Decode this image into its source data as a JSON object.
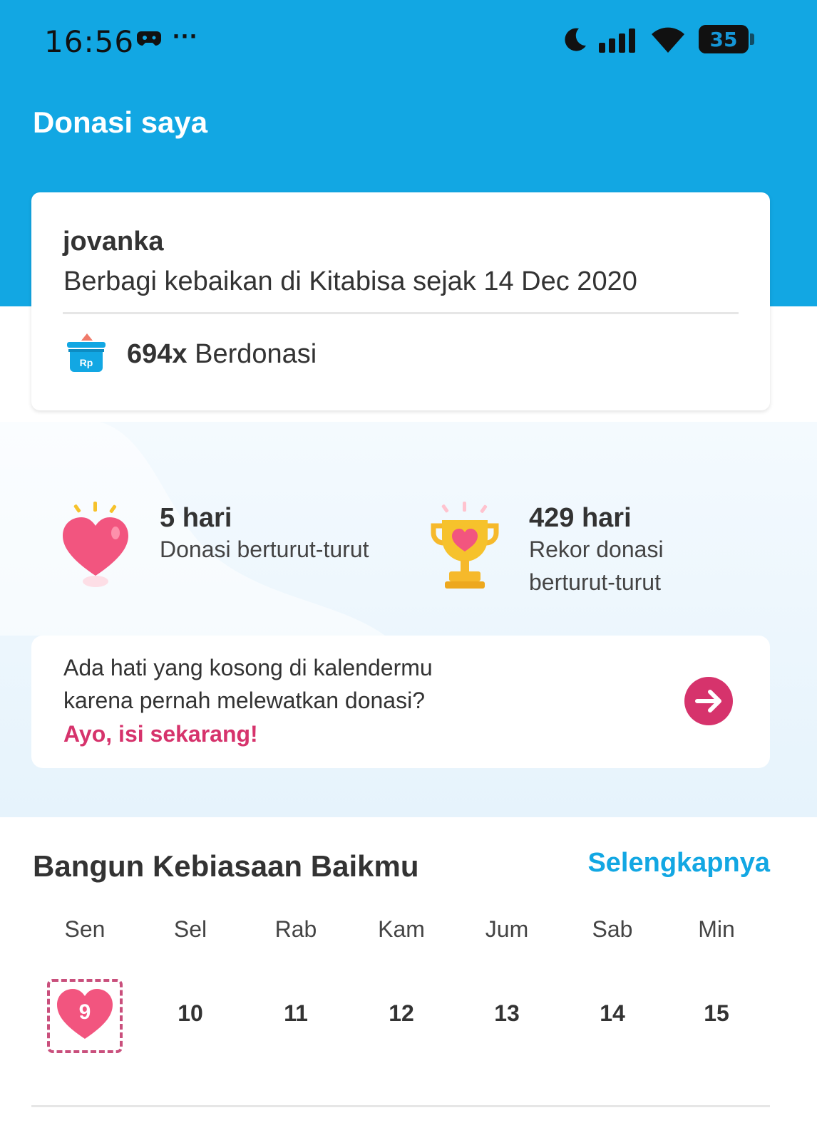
{
  "status_bar": {
    "time": "16:56",
    "more": "···",
    "battery": "35",
    "icons": [
      "game-controller-icon",
      "moon-icon",
      "signal-icon",
      "wifi-icon",
      "battery-icon"
    ]
  },
  "header": {
    "title": "Donasi saya"
  },
  "profile": {
    "name": "jovanka",
    "since": "Berbagi kebaikan di Kitabisa sejak 14 Dec 2020",
    "donation_count": "694x",
    "donation_label": " Berdonasi",
    "icon_label": "Rp"
  },
  "streak": {
    "current_value": "5 hari",
    "current_label": "Donasi berturut-turut",
    "record_value": "429 hari",
    "record_label": "Rekor donasi berturut-turut"
  },
  "fill_card": {
    "text": "Ada hati yang kosong di kalendermu karena pernah melewatkan donasi?",
    "cta": "Ayo, isi sekarang!"
  },
  "habit": {
    "title": "Bangun Kebiasaan Baikmu",
    "more_link": "Selengkapnya",
    "weekdays": [
      "Sen",
      "Sel",
      "Rab",
      "Kam",
      "Jum",
      "Sab",
      "Min"
    ],
    "days": [
      "9",
      "10",
      "11",
      "12",
      "13",
      "14",
      "15"
    ],
    "today": "9"
  },
  "colors": {
    "header": "#12a7e3",
    "accent_pink": "#d6336c",
    "link_blue": "#12a7e3"
  }
}
